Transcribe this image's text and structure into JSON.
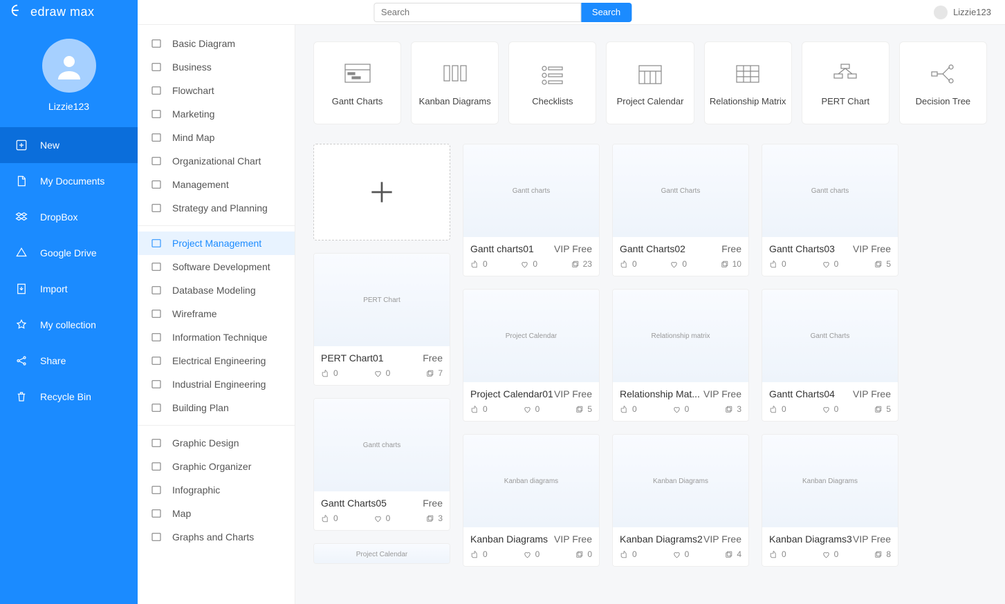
{
  "app": {
    "logo_text": "edraw max"
  },
  "search": {
    "placeholder": "Search",
    "button": "Search"
  },
  "user": {
    "name": "Lizzie123"
  },
  "sidebar": {
    "username": "Lizzie123",
    "items": [
      {
        "label": "New",
        "icon": "plus-box-icon",
        "active": true
      },
      {
        "label": "My Documents",
        "icon": "document-icon"
      },
      {
        "label": "DropBox",
        "icon": "dropbox-icon"
      },
      {
        "label": "Google Drive",
        "icon": "google-drive-icon"
      },
      {
        "label": "Import",
        "icon": "import-icon"
      },
      {
        "label": "My collection",
        "icon": "star-icon"
      },
      {
        "label": "Share",
        "icon": "share-icon"
      },
      {
        "label": "Recycle Bin",
        "icon": "trash-icon"
      }
    ]
  },
  "categories": {
    "group1": [
      {
        "label": "Basic Diagram",
        "icon": "shapes-icon"
      },
      {
        "label": "Business",
        "icon": "briefcase-icon"
      },
      {
        "label": "Flowchart",
        "icon": "flow-icon"
      },
      {
        "label": "Marketing",
        "icon": "chart-icon"
      },
      {
        "label": "Mind Map",
        "icon": "mindmap-icon"
      },
      {
        "label": "Organizational Chart",
        "icon": "org-icon"
      },
      {
        "label": "Management",
        "icon": "gear-icon"
      },
      {
        "label": "Strategy and Planning",
        "icon": "strategy-icon"
      }
    ],
    "group2": [
      {
        "label": "Project Management",
        "icon": "project-icon",
        "active": true
      },
      {
        "label": "Software Development",
        "icon": "software-icon"
      },
      {
        "label": "Database Modeling",
        "icon": "database-icon"
      },
      {
        "label": "Wireframe",
        "icon": "wireframe-icon"
      },
      {
        "label": "Information Technique",
        "icon": "info-icon"
      },
      {
        "label": "Electrical Engineering",
        "icon": "electrical-icon"
      },
      {
        "label": "Industrial Engineering",
        "icon": "industrial-icon"
      },
      {
        "label": "Building Plan",
        "icon": "building-icon"
      }
    ],
    "group3": [
      {
        "label": "Graphic Design",
        "icon": "graphic-icon"
      },
      {
        "label": "Graphic Organizer",
        "icon": "organizer-icon"
      },
      {
        "label": "Infographic",
        "icon": "infographic-icon"
      },
      {
        "label": "Map",
        "icon": "map-icon"
      },
      {
        "label": "Graphs and Charts",
        "icon": "graphs-icon"
      }
    ]
  },
  "types": [
    {
      "label": "Gantt Charts",
      "icon": "gantt-icon"
    },
    {
      "label": "Kanban Diagrams",
      "icon": "kanban-icon"
    },
    {
      "label": "Checklists",
      "icon": "checklist-icon"
    },
    {
      "label": "Project Calendar",
      "icon": "calendar-icon"
    },
    {
      "label": "Relationship Matrix",
      "icon": "matrix-icon"
    },
    {
      "label": "PERT Chart",
      "icon": "pert-icon"
    },
    {
      "label": "Decision Tree",
      "icon": "tree-icon"
    }
  ],
  "templates_col0": [
    {
      "name": "PERT Chart01",
      "badge": "Free",
      "likes": "0",
      "favs": "0",
      "copies": "7",
      "thumb": "PERT Chart"
    },
    {
      "name": "Gantt Charts05",
      "badge": "Free",
      "likes": "0",
      "favs": "0",
      "copies": "3",
      "thumb": "Gantt charts"
    },
    {
      "name": "",
      "badge": "",
      "likes": "",
      "favs": "",
      "copies": "",
      "thumb": "Project Calendar",
      "partial": true
    }
  ],
  "templates_grid": [
    {
      "name": "Gantt charts01",
      "badge": "VIP Free",
      "likes": "0",
      "favs": "0",
      "copies": "23",
      "thumb": "Gantt charts"
    },
    {
      "name": "Gantt Charts02",
      "badge": "Free",
      "likes": "0",
      "favs": "0",
      "copies": "10",
      "thumb": "Gantt Charts"
    },
    {
      "name": "Gantt Charts03",
      "badge": "VIP Free",
      "likes": "0",
      "favs": "0",
      "copies": "5",
      "thumb": "Gantt charts"
    },
    {
      "name": "Project Calendar01",
      "badge": "VIP Free",
      "likes": "0",
      "favs": "0",
      "copies": "5",
      "thumb": "Project Calendar"
    },
    {
      "name": "Relationship Mat...",
      "badge": "VIP Free",
      "likes": "0",
      "favs": "0",
      "copies": "3",
      "thumb": "Relationship matrix"
    },
    {
      "name": "Gantt Charts04",
      "badge": "VIP Free",
      "likes": "0",
      "favs": "0",
      "copies": "5",
      "thumb": "Gantt Charts"
    },
    {
      "name": "Kanban Diagrams",
      "badge": "VIP Free",
      "likes": "0",
      "favs": "0",
      "copies": "0",
      "thumb": "Kanban diagrams"
    },
    {
      "name": "Kanban Diagrams2",
      "badge": "VIP Free",
      "likes": "0",
      "favs": "0",
      "copies": "4",
      "thumb": "Kanban Diagrams"
    },
    {
      "name": "Kanban Diagrams3",
      "badge": "VIP Free",
      "likes": "0",
      "favs": "0",
      "copies": "8",
      "thumb": "Kanban Diagrams"
    }
  ]
}
